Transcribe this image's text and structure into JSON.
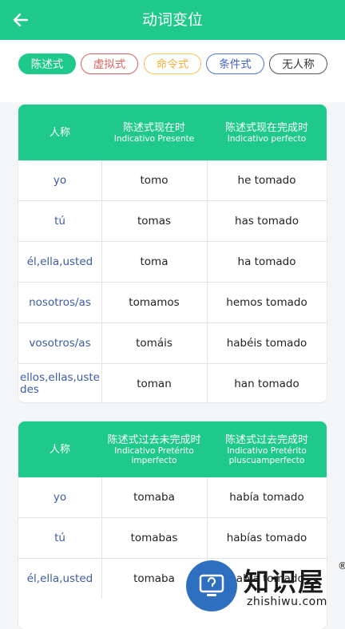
{
  "header": {
    "title": "动词变位"
  },
  "moods": [
    "陈述式",
    "虚拟式",
    "命令式",
    "条件式",
    "无人称"
  ],
  "colors": {
    "accent": "#1ec98b"
  },
  "table1": {
    "headers": [
      {
        "main": "人称",
        "sub": ""
      },
      {
        "main": "陈述式现在时",
        "sub": "Indicativo Presente"
      },
      {
        "main": "陈述式现在完成时",
        "sub": "Indicativo perfecto"
      }
    ],
    "rows": [
      [
        "yo",
        "tomo",
        "he tomado"
      ],
      [
        "tú",
        "tomas",
        "has tomado"
      ],
      [
        "él,ella,usted",
        "toma",
        "ha tomado"
      ],
      [
        "nosotros/as",
        "tomamos",
        "hemos tomado"
      ],
      [
        "vosotros/as",
        "tomáis",
        "habéis tomado"
      ],
      [
        "ellos,ellas,ustedes",
        "toman",
        "han tomado"
      ]
    ]
  },
  "table2": {
    "headers": [
      {
        "main": "人称",
        "sub": ""
      },
      {
        "main": "陈述式过去未完成时",
        "sub": "Indicativo Pretérito imperfecto"
      },
      {
        "main": "陈述式过去完成时",
        "sub": "Indicativo Pretérito pluscuamperfecto"
      }
    ],
    "rows": [
      [
        "yo",
        "tomaba",
        "había tomado"
      ],
      [
        "tú",
        "tomabas",
        "habías tomado"
      ],
      [
        "él,ella,usted",
        "tomaba",
        "había tomado"
      ]
    ]
  },
  "watermark": {
    "brand": "知识屋",
    "url": "zhishiwu.com",
    "reg": "®"
  }
}
